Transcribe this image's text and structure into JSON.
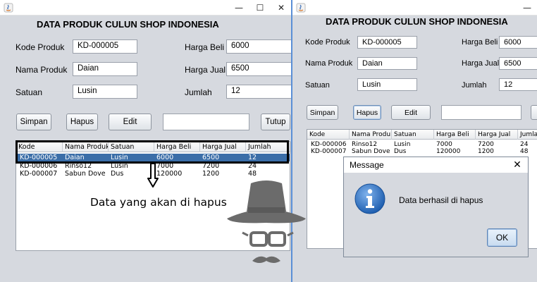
{
  "left_window": {
    "title": "DATA PRODUK CULUN SHOP INDONESIA",
    "labels": {
      "kode_produk": "Kode Produk",
      "nama_produk": "Nama Produk",
      "satuan": "Satuan",
      "harga_beli": "Harga Beli",
      "harga_jual": "Harga Jual",
      "jumlah": "Jumlah"
    },
    "values": {
      "kode_produk": "KD-000005",
      "nama_produk": "Daian",
      "satuan": "Lusin",
      "harga_beli": "6000",
      "harga_jual": "6500",
      "jumlah": "12"
    },
    "buttons": {
      "simpan": "Simpan",
      "hapus": "Hapus",
      "edit": "Edit",
      "tutup": "Tutup"
    },
    "search_value": "",
    "table": {
      "columns": [
        "Kode",
        "Nama Produk",
        "Satuan",
        "Harga Beli",
        "Harga Jual",
        "Jumlah"
      ],
      "rows": [
        [
          "KD-000005",
          "Daian",
          "Lusin",
          "6000",
          "6500",
          "12"
        ],
        [
          "KD-000006",
          "Rinso12",
          "Lusin",
          "7000",
          "7200",
          "24"
        ],
        [
          "KD-000007",
          "Sabun Dove",
          "Dus",
          "120000",
          "1200",
          "48"
        ]
      ],
      "selected_row": 0
    },
    "annotation": "Data yang akan di hapus"
  },
  "right_window": {
    "title": "DATA PRODUK CULUN SHOP INDONESIA",
    "labels": {
      "kode_produk": "Kode Produk",
      "nama_produk": "Nama Produk",
      "satuan": "Satuan",
      "harga_beli": "Harga Beli",
      "harga_jual": "Harga Jual",
      "jumlah": "Jumlah"
    },
    "values": {
      "kode_produk": "KD-000005",
      "nama_produk": "Daian",
      "satuan": "Lusin",
      "harga_beli": "6000",
      "harga_jual": "6500",
      "jumlah": "12"
    },
    "buttons": {
      "simpan": "Simpan",
      "hapus": "Hapus",
      "edit": "Edit"
    },
    "search_value": "",
    "table": {
      "columns": [
        "Kode",
        "Nama Produk",
        "Satuan",
        "Harga Beli",
        "Harga Jual",
        "Jumlah"
      ],
      "rows": [
        [
          "KD-000006",
          "Rinso12",
          "Lusin",
          "7000",
          "7200",
          "24"
        ],
        [
          "KD-000007",
          "Sabun Dove",
          "Dus",
          "120000",
          "1200",
          "48"
        ]
      ]
    }
  },
  "dialog": {
    "title": "Message",
    "message": "Data berhasil di hapus",
    "ok_label": "OK",
    "icon": "information-icon"
  },
  "colors": {
    "window_bg": "#d6d9df",
    "selection": "#3b6ea8",
    "highlight_border": "#000000",
    "info_icon": "#2a6ebd",
    "logo": "#6b6b6b"
  }
}
